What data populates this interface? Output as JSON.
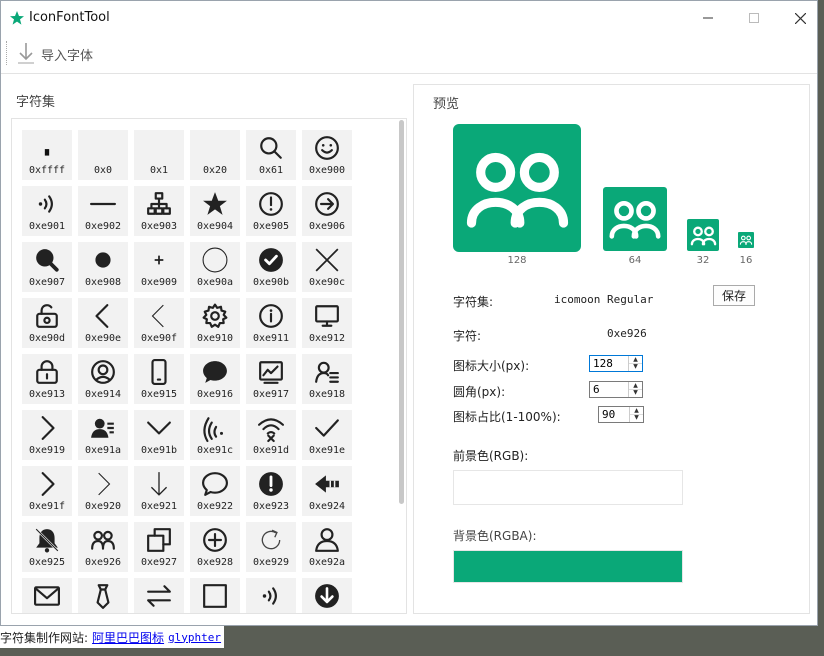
{
  "app": {
    "title": "IconFontTool"
  },
  "toolbar": {
    "import_label": "导入字体"
  },
  "charset": {
    "title": "字符集"
  },
  "glyphs": [
    {
      "code": "0xffff",
      "icon": "small-square-icon"
    },
    {
      "code": "0x0",
      "icon": "empty-glyph"
    },
    {
      "code": "0x1",
      "icon": "empty-glyph"
    },
    {
      "code": "0x20",
      "icon": "empty-glyph"
    },
    {
      "code": "0x61",
      "icon": "search-icon"
    },
    {
      "code": "0xe900",
      "icon": "smiley-icon"
    },
    {
      "code": "0xe901",
      "icon": "signal-icon"
    },
    {
      "code": "0xe902",
      "icon": "minus-icon"
    },
    {
      "code": "0xe903",
      "icon": "sitemap-icon"
    },
    {
      "code": "0xe904",
      "icon": "star-icon"
    },
    {
      "code": "0xe905",
      "icon": "alert-circle-icon"
    },
    {
      "code": "0xe906",
      "icon": "arrow-right-circle-icon"
    },
    {
      "code": "0xe907",
      "icon": "search-filled-icon"
    },
    {
      "code": "0xe908",
      "icon": "dot-icon"
    },
    {
      "code": "0xe909",
      "icon": "plus-small-icon"
    },
    {
      "code": "0xe90a",
      "icon": "circle-icon"
    },
    {
      "code": "0xe90b",
      "icon": "check-circle-icon"
    },
    {
      "code": "0xe90c",
      "icon": "close-icon"
    },
    {
      "code": "0xe90d",
      "icon": "lock-refresh-icon"
    },
    {
      "code": "0xe90e",
      "icon": "chevron-left-icon"
    },
    {
      "code": "0xe90f",
      "icon": "chevron-left-thin-icon"
    },
    {
      "code": "0xe910",
      "icon": "gear-icon"
    },
    {
      "code": "0xe911",
      "icon": "info-icon"
    },
    {
      "code": "0xe912",
      "icon": "monitor-icon"
    },
    {
      "code": "0xe913",
      "icon": "lock-icon"
    },
    {
      "code": "0xe914",
      "icon": "user-circle-icon"
    },
    {
      "code": "0xe915",
      "icon": "phone-icon"
    },
    {
      "code": "0xe916",
      "icon": "chat-bubble-icon"
    },
    {
      "code": "0xe917",
      "icon": "chart-line-icon"
    },
    {
      "code": "0xe918",
      "icon": "user-list-icon"
    },
    {
      "code": "0xe919",
      "icon": "chevron-right-icon"
    },
    {
      "code": "0xe91a",
      "icon": "user-card-icon"
    },
    {
      "code": "0xe91b",
      "icon": "chevron-down-icon"
    },
    {
      "code": "0xe91c",
      "icon": "wifi-side-icon"
    },
    {
      "code": "0xe91d",
      "icon": "wifi-off-icon"
    },
    {
      "code": "0xe91e",
      "icon": "check-icon"
    },
    {
      "code": "0xe91f",
      "icon": "chevron-right-icon"
    },
    {
      "code": "0xe920",
      "icon": "chevron-right-thin-icon"
    },
    {
      "code": "0xe921",
      "icon": "arrow-down-icon"
    },
    {
      "code": "0xe922",
      "icon": "chat-outline-icon"
    },
    {
      "code": "0xe923",
      "icon": "alert-filled-icon"
    },
    {
      "code": "0xe924",
      "icon": "arrow-left-bold-icon"
    },
    {
      "code": "0xe925",
      "icon": "bell-off-icon"
    },
    {
      "code": "0xe926",
      "icon": "users-icon"
    },
    {
      "code": "0xe927",
      "icon": "copy-icon"
    },
    {
      "code": "0xe928",
      "icon": "plus-circle-icon"
    },
    {
      "code": "0xe929",
      "icon": "refresh-icon"
    },
    {
      "code": "0xe92a",
      "icon": "user-icon"
    },
    {
      "code": "",
      "icon": "mail-icon"
    },
    {
      "code": "",
      "icon": "tie-icon"
    },
    {
      "code": "",
      "icon": "swap-icon"
    },
    {
      "code": "",
      "icon": "square-icon"
    },
    {
      "code": "",
      "icon": "signal-icon"
    },
    {
      "code": "",
      "icon": "arrow-down-circle-icon"
    }
  ],
  "preview": {
    "title": "预览",
    "sizes": [
      "128",
      "64",
      "32",
      "16"
    ],
    "charset_label": "字符集:",
    "charset_value": "icomoon Regular",
    "save_label": "保存",
    "char_label": "字符:",
    "char_value": "0xe926",
    "size_label": "图标大小(px):",
    "size_value": "128",
    "radius_label": "圆角(px):",
    "radius_value": "6",
    "ratio_label": "图标占比(1-100%):",
    "ratio_value": "90",
    "fg_label": "前景色(RGB):",
    "bg_label": "背景色(RGBA):",
    "fg_color": "#ffffff",
    "bg_color": "#0aa878"
  },
  "status": {
    "prefix": "字符集制作网站:",
    "link1": "阿里巴巴图标",
    "link2": "glyphter"
  },
  "colors": {
    "accent": "#0aa878",
    "link": "#0000ee"
  }
}
